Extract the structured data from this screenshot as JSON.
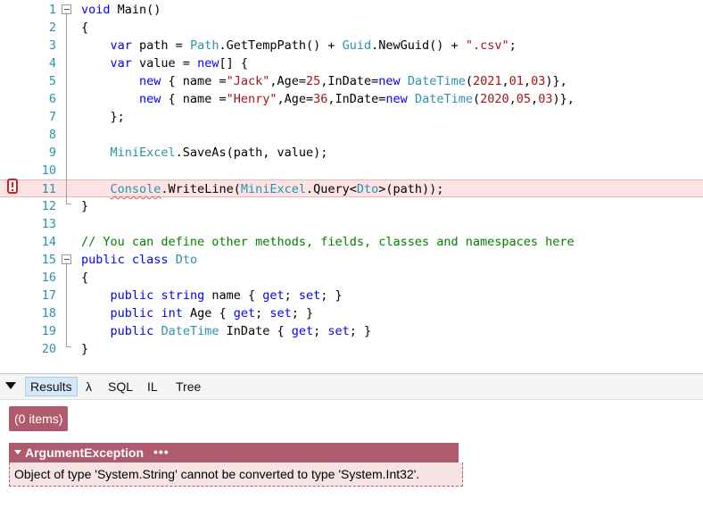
{
  "editor": {
    "lines": [
      {
        "n": "1",
        "tokens": [
          {
            "c": "kw",
            "t": "void"
          },
          {
            "c": "",
            "t": " Main()"
          }
        ]
      },
      {
        "n": "2",
        "tokens": [
          {
            "c": "",
            "t": "{"
          }
        ]
      },
      {
        "n": "3",
        "tokens": [
          {
            "c": "",
            "t": "    "
          },
          {
            "c": "kw",
            "t": "var"
          },
          {
            "c": "",
            "t": " path = "
          },
          {
            "c": "ty",
            "t": "Path"
          },
          {
            "c": "",
            "t": ".GetTempPath() + "
          },
          {
            "c": "ty",
            "t": "Guid"
          },
          {
            "c": "",
            "t": ".NewGuid() + "
          },
          {
            "c": "st",
            "t": "\".csv\""
          },
          {
            "c": "",
            "t": ";"
          }
        ]
      },
      {
        "n": "4",
        "tokens": [
          {
            "c": "",
            "t": "    "
          },
          {
            "c": "kw",
            "t": "var"
          },
          {
            "c": "",
            "t": " value = "
          },
          {
            "c": "kw",
            "t": "new"
          },
          {
            "c": "",
            "t": "[] {"
          }
        ]
      },
      {
        "n": "5",
        "tokens": [
          {
            "c": "",
            "t": "        "
          },
          {
            "c": "kw",
            "t": "new"
          },
          {
            "c": "",
            "t": " { name ="
          },
          {
            "c": "st",
            "t": "\"Jack\""
          },
          {
            "c": "",
            "t": ",Age="
          },
          {
            "c": "nm",
            "t": "25"
          },
          {
            "c": "",
            "t": ",InDate="
          },
          {
            "c": "kw",
            "t": "new"
          },
          {
            "c": "",
            "t": " "
          },
          {
            "c": "ty",
            "t": "DateTime"
          },
          {
            "c": "",
            "t": "("
          },
          {
            "c": "nm",
            "t": "2021"
          },
          {
            "c": "",
            "t": ","
          },
          {
            "c": "nm",
            "t": "01"
          },
          {
            "c": "",
            "t": ","
          },
          {
            "c": "nm",
            "t": "03"
          },
          {
            "c": "",
            "t": ")},"
          }
        ]
      },
      {
        "n": "6",
        "tokens": [
          {
            "c": "",
            "t": "        "
          },
          {
            "c": "kw",
            "t": "new"
          },
          {
            "c": "",
            "t": " { name ="
          },
          {
            "c": "st",
            "t": "\"Henry\""
          },
          {
            "c": "",
            "t": ",Age="
          },
          {
            "c": "nm",
            "t": "36"
          },
          {
            "c": "",
            "t": ",InDate="
          },
          {
            "c": "kw",
            "t": "new"
          },
          {
            "c": "",
            "t": " "
          },
          {
            "c": "ty",
            "t": "DateTime"
          },
          {
            "c": "",
            "t": "("
          },
          {
            "c": "nm",
            "t": "2020"
          },
          {
            "c": "",
            "t": ","
          },
          {
            "c": "nm",
            "t": "05"
          },
          {
            "c": "",
            "t": ","
          },
          {
            "c": "nm",
            "t": "03"
          },
          {
            "c": "",
            "t": ")},"
          }
        ]
      },
      {
        "n": "7",
        "tokens": [
          {
            "c": "",
            "t": "    };"
          }
        ]
      },
      {
        "n": "8",
        "tokens": []
      },
      {
        "n": "9",
        "tokens": [
          {
            "c": "",
            "t": "    "
          },
          {
            "c": "ty",
            "t": "MiniExcel"
          },
          {
            "c": "",
            "t": ".SaveAs(path, value);"
          }
        ]
      },
      {
        "n": "10",
        "tokens": []
      },
      {
        "n": "11",
        "tokens": [
          {
            "c": "",
            "t": "    "
          },
          {
            "c": "ty squig",
            "t": "Console"
          },
          {
            "c": "",
            "t": ".WriteLine("
          },
          {
            "c": "ty",
            "t": "MiniExcel"
          },
          {
            "c": "",
            "t": ".Query<"
          },
          {
            "c": "ty",
            "t": "Dto"
          },
          {
            "c": "",
            "t": ">(path));"
          }
        ]
      },
      {
        "n": "12",
        "tokens": [
          {
            "c": "",
            "t": "}"
          }
        ]
      },
      {
        "n": "13",
        "tokens": []
      },
      {
        "n": "14",
        "tokens": [
          {
            "c": "cm",
            "t": "// You can define other methods, fields, classes and namespaces here"
          }
        ]
      },
      {
        "n": "15",
        "tokens": [
          {
            "c": "kw",
            "t": "public"
          },
          {
            "c": "",
            "t": " "
          },
          {
            "c": "kw",
            "t": "class"
          },
          {
            "c": "",
            "t": " "
          },
          {
            "c": "ty",
            "t": "Dto"
          }
        ]
      },
      {
        "n": "16",
        "tokens": [
          {
            "c": "",
            "t": "{"
          }
        ]
      },
      {
        "n": "17",
        "tokens": [
          {
            "c": "",
            "t": "    "
          },
          {
            "c": "kw",
            "t": "public"
          },
          {
            "c": "",
            "t": " "
          },
          {
            "c": "kw",
            "t": "string"
          },
          {
            "c": "",
            "t": " name { "
          },
          {
            "c": "kw",
            "t": "get"
          },
          {
            "c": "",
            "t": "; "
          },
          {
            "c": "kw",
            "t": "set"
          },
          {
            "c": "",
            "t": "; }"
          }
        ]
      },
      {
        "n": "18",
        "tokens": [
          {
            "c": "",
            "t": "    "
          },
          {
            "c": "kw",
            "t": "public"
          },
          {
            "c": "",
            "t": " "
          },
          {
            "c": "kw",
            "t": "int"
          },
          {
            "c": "",
            "t": " Age { "
          },
          {
            "c": "kw",
            "t": "get"
          },
          {
            "c": "",
            "t": "; "
          },
          {
            "c": "kw",
            "t": "set"
          },
          {
            "c": "",
            "t": "; }"
          }
        ]
      },
      {
        "n": "19",
        "tokens": [
          {
            "c": "",
            "t": "    "
          },
          {
            "c": "kw",
            "t": "public"
          },
          {
            "c": "",
            "t": " "
          },
          {
            "c": "ty",
            "t": "DateTime"
          },
          {
            "c": "",
            "t": " InDate { "
          },
          {
            "c": "kw",
            "t": "get"
          },
          {
            "c": "",
            "t": "; "
          },
          {
            "c": "kw",
            "t": "set"
          },
          {
            "c": "",
            "t": "; }"
          }
        ]
      },
      {
        "n": "20",
        "tokens": [
          {
            "c": "",
            "t": "}"
          }
        ]
      }
    ],
    "breakpoint_line": "11",
    "fold_lines": [
      "1",
      "15"
    ]
  },
  "tabs": {
    "results": "Results",
    "lambda": "λ",
    "sql": "SQL",
    "il": "IL",
    "tree": "Tree"
  },
  "output": {
    "items_badge": "(0 items)",
    "exception": {
      "type": "ArgumentException",
      "more": "•••",
      "message": "Object of type 'System.String' cannot be converted to type 'System.Int32'."
    }
  },
  "colors": {
    "keyword": "#0000ff",
    "type": "#2b91af",
    "string": "#a31515",
    "comment": "#008000",
    "exception_bg": "#b05a6e",
    "breakpoint_line_bg": "#fbe3e3"
  },
  "icons": {
    "breakpoint": "breakpoint-error-icon",
    "collapse": "collapse-triangle-icon",
    "fold": "fold-minus-icon"
  }
}
